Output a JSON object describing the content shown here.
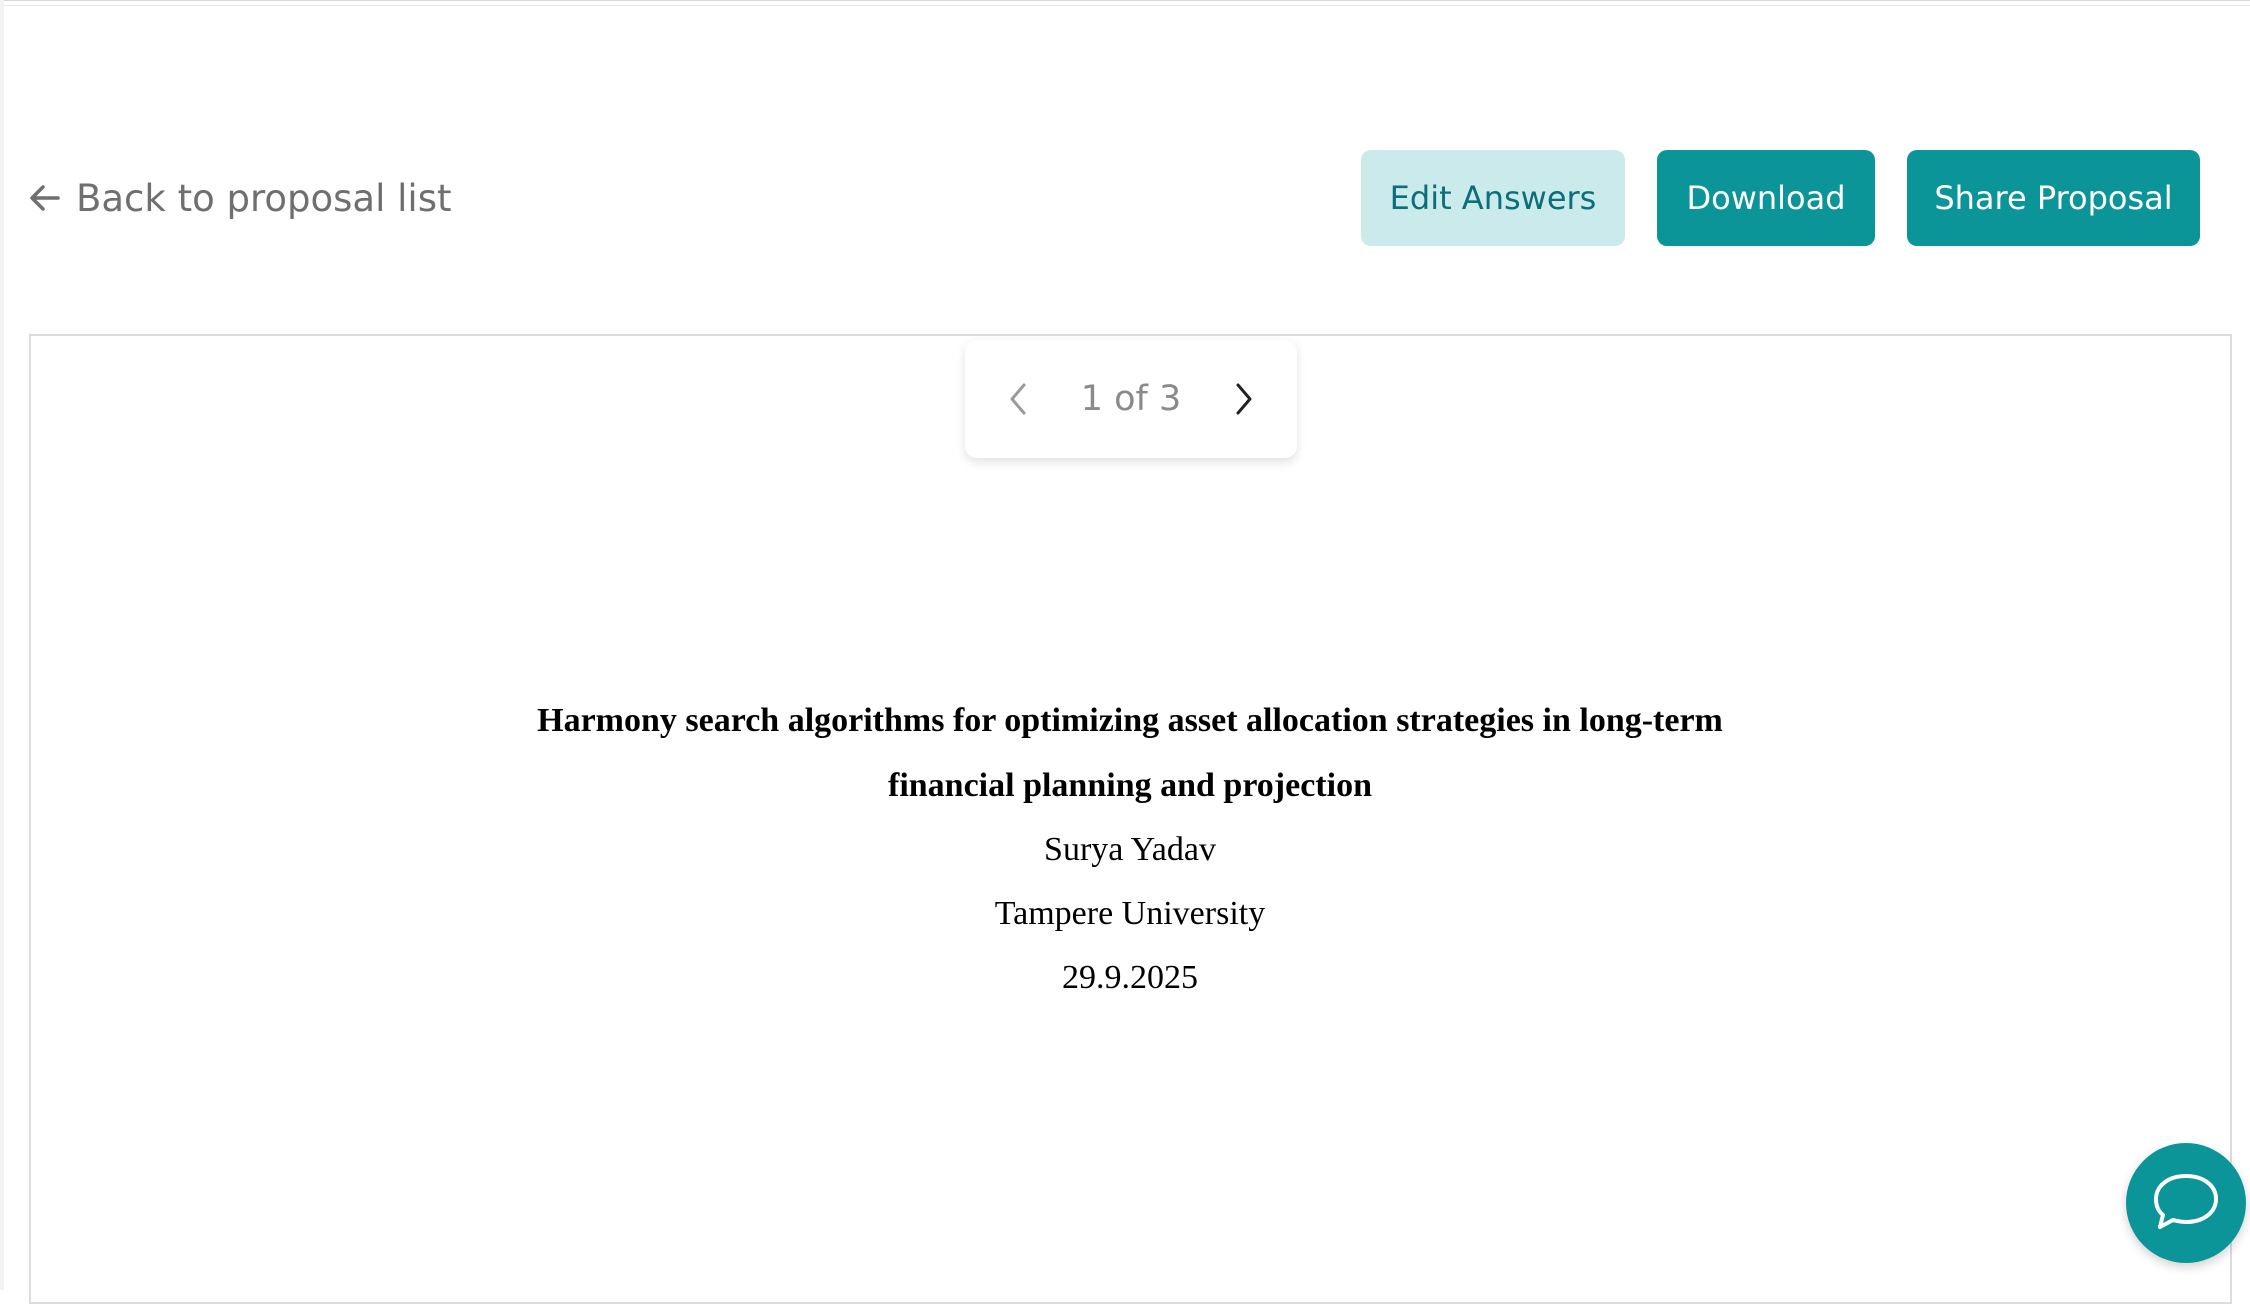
{
  "header": {
    "back_label": "Back to proposal list",
    "edit_label": "Edit Answers",
    "download_label": "Download",
    "share_label": "Share Proposal"
  },
  "pager": {
    "text": "1 of 3",
    "current_page": 1,
    "total_pages": 3
  },
  "document": {
    "title_line1": "Harmony search algorithms for optimizing asset allocation strategies in long-term",
    "title_line2": "financial planning and projection",
    "author": "Surya Yadav",
    "institution": "Tampere University",
    "date": "29.9.2025"
  },
  "icons": {
    "back": "arrow-left-icon",
    "prev": "chevron-left-icon",
    "next": "chevron-right-icon",
    "chat": "chat-bubble-icon"
  },
  "colors": {
    "primary": "#0b9599",
    "primary_light": "#cbeaec",
    "primary_text_on_light": "#0a6f78",
    "muted_text": "#6f6f6f"
  }
}
